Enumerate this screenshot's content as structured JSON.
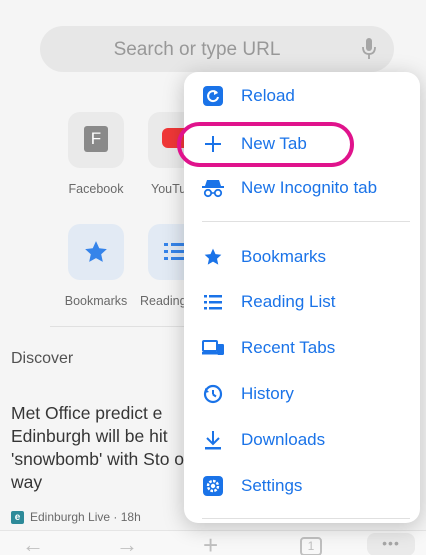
{
  "search": {
    "placeholder": "Search or type URL"
  },
  "tiles": [
    {
      "label": "Facebook",
      "letter": "F"
    },
    {
      "label": "YouTu"
    },
    {
      "label": "Bookmarks"
    },
    {
      "label": "Reading"
    }
  ],
  "discover": {
    "title": "Discover"
  },
  "article": {
    "headline": "Met Office predict e Edinburgh will be hit 'snowbomb' with Sto on way",
    "source_badge": "e",
    "source": "Edinburgh Live · 18h"
  },
  "menu": {
    "items": [
      {
        "label": "Reload",
        "icon": "reload-icon"
      },
      {
        "label": "New Tab",
        "icon": "plus-icon"
      },
      {
        "label": "New Incognito tab",
        "icon": "incognito-icon"
      },
      {
        "label": "Bookmarks",
        "icon": "star-icon"
      },
      {
        "label": "Reading List",
        "icon": "reading-list-icon"
      },
      {
        "label": "Recent Tabs",
        "icon": "devices-icon"
      },
      {
        "label": "History",
        "icon": "history-icon"
      },
      {
        "label": "Downloads",
        "icon": "download-icon"
      },
      {
        "label": "Settings",
        "icon": "gear-icon"
      }
    ]
  },
  "toolbar": {
    "tab_count": "1",
    "more": "•••"
  },
  "colors": {
    "accent": "#1a73e8",
    "highlight": "#e0138c"
  }
}
